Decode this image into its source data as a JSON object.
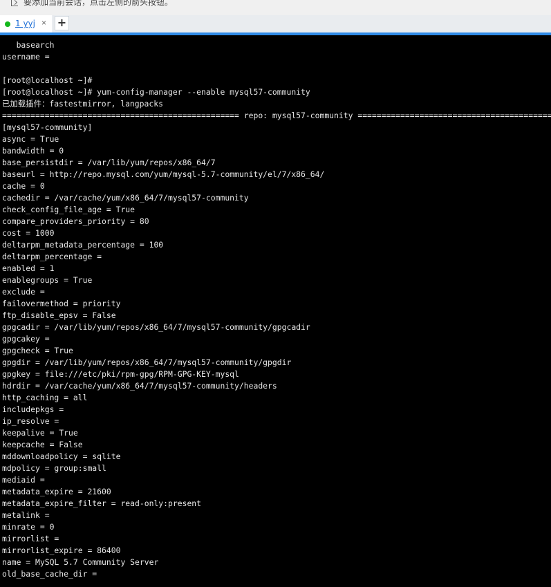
{
  "hint_bar": {
    "text": "要添加当前会话，点击左侧的箭头按钮。",
    "icon": "arrow-icon"
  },
  "tabs": [
    {
      "label": "1 yyj",
      "status_color": "#13b81b",
      "close": "×"
    }
  ],
  "add_tab_label": "+",
  "terminal": {
    "lines": [
      "   basearch",
      "username =",
      "",
      "[root@localhost ~]#",
      "[root@localhost ~]# yum-config-manager --enable mysql57-community",
      "已加载插件：fastestmirror, langpacks",
      "================================================== repo: mysql57-community ==================================================",
      "[mysql57-community]",
      "async = True",
      "bandwidth = 0",
      "base_persistdir = /var/lib/yum/repos/x86_64/7",
      "baseurl = http://repo.mysql.com/yum/mysql-5.7-community/el/7/x86_64/",
      "cache = 0",
      "cachedir = /var/cache/yum/x86_64/7/mysql57-community",
      "check_config_file_age = True",
      "compare_providers_priority = 80",
      "cost = 1000",
      "deltarpm_metadata_percentage = 100",
      "deltarpm_percentage =",
      "enabled = 1",
      "enablegroups = True",
      "exclude =",
      "failovermethod = priority",
      "ftp_disable_epsv = False",
      "gpgcadir = /var/lib/yum/repos/x86_64/7/mysql57-community/gpgcadir",
      "gpgcakey =",
      "gpgcheck = True",
      "gpgdir = /var/lib/yum/repos/x86_64/7/mysql57-community/gpgdir",
      "gpgkey = file:///etc/pki/rpm-gpg/RPM-GPG-KEY-mysql",
      "hdrdir = /var/cache/yum/x86_64/7/mysql57-community/headers",
      "http_caching = all",
      "includepkgs =",
      "ip_resolve =",
      "keepalive = True",
      "keepcache = False",
      "mddownloadpolicy = sqlite",
      "mdpolicy = group:small",
      "mediaid =",
      "metadata_expire = 21600",
      "metadata_expire_filter = read-only:present",
      "metalink =",
      "minrate = 0",
      "mirrorlist =",
      "mirrorlist_expire = 86400",
      "name = MySQL 5.7 Community Server",
      "old_base_cache_dir ="
    ]
  }
}
